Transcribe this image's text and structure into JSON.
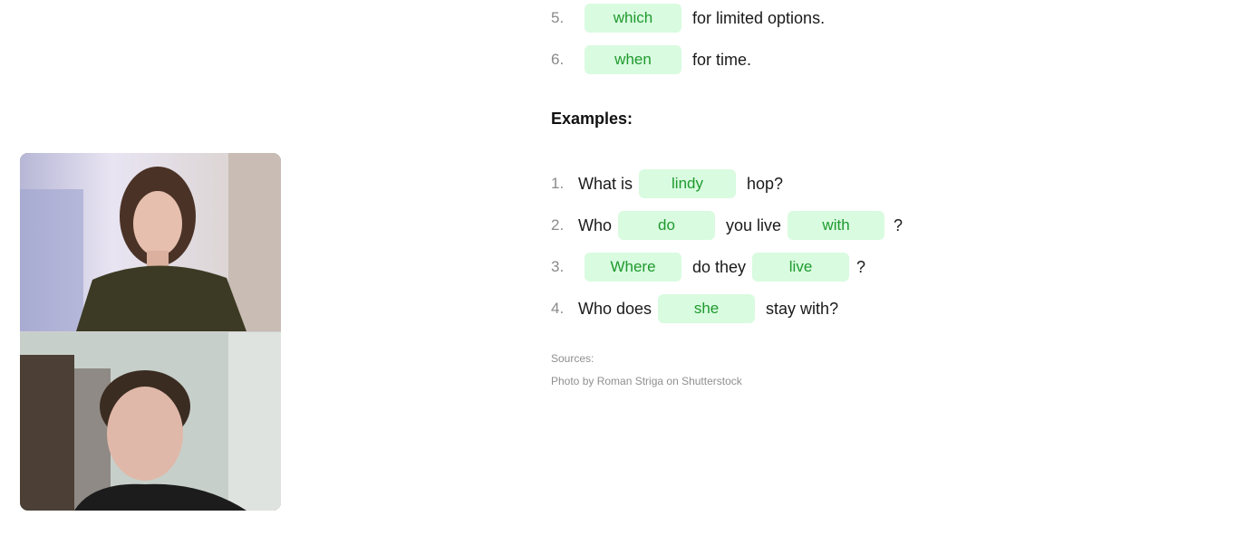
{
  "rules": [
    {
      "num": "5.",
      "chip": "which",
      "text": "for limited options."
    },
    {
      "num": "6.",
      "chip": "when",
      "text": "for time."
    }
  ],
  "examples_heading": "Examples:",
  "examples": [
    {
      "num": "1.",
      "pre": "What is",
      "chip": "lindy",
      "post": "hop?"
    },
    {
      "num": "2.",
      "pre": "Who",
      "chip": "do",
      "mid": "you live",
      "chip2": "with",
      "post": "?"
    },
    {
      "num": "3.",
      "chip": "Where",
      "mid": "do they",
      "chip2": "live",
      "post": "?"
    },
    {
      "num": "4.",
      "pre": "Who does",
      "chip": "she",
      "post": "stay with?"
    }
  ],
  "sources_label": "Sources:",
  "photo_credit": "Photo by Roman Striga on Shutterstock",
  "colors": {
    "chip_bg": "#d9fbe0",
    "chip_text": "#1f9a2e"
  }
}
